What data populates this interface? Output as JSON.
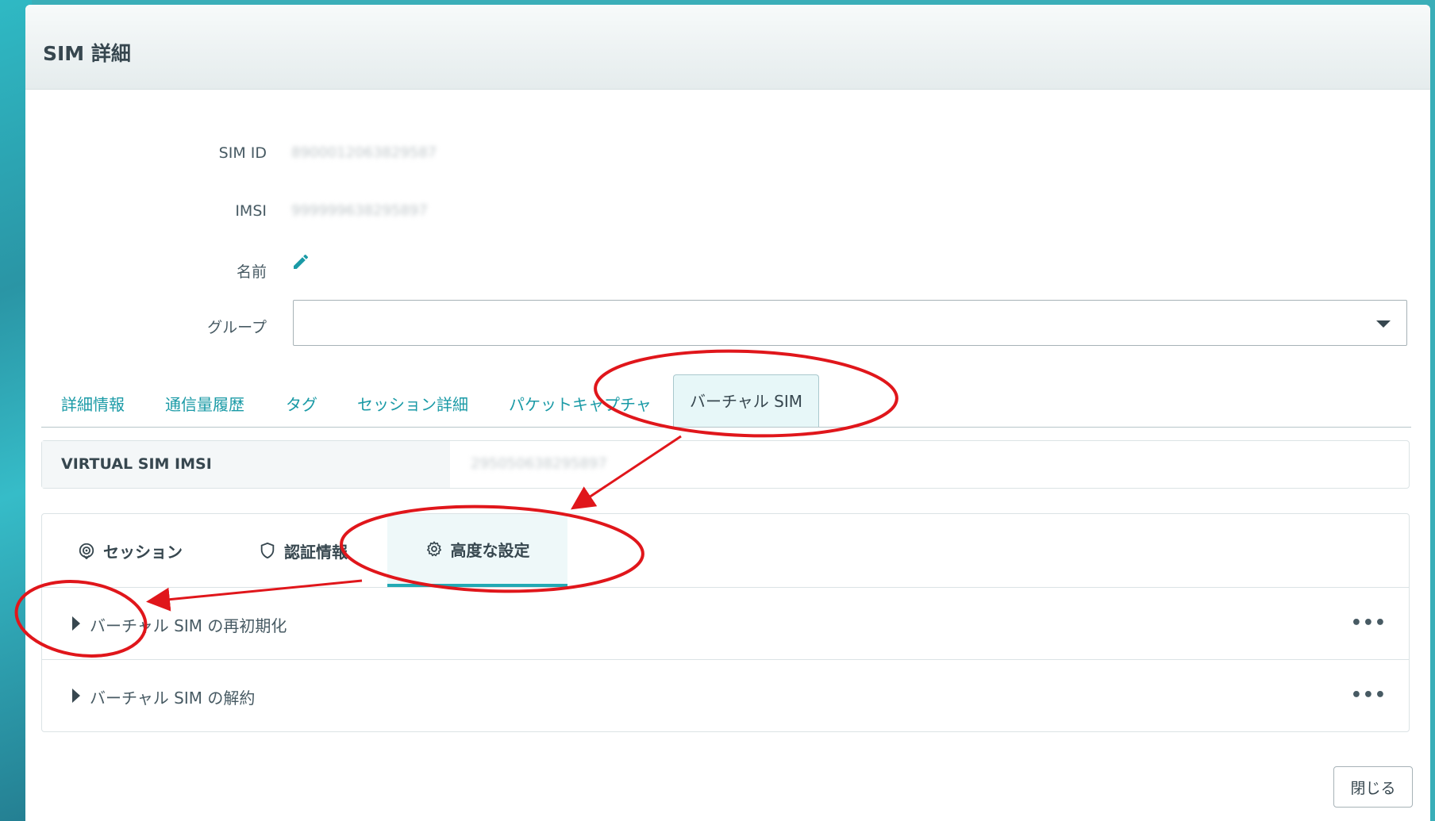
{
  "modal": {
    "title": "SIM 詳細"
  },
  "fields": {
    "sim_id_label": "SIM ID",
    "sim_id_value": "8900012063829587",
    "imsi_label": "IMSI",
    "imsi_value": "999999638295897",
    "name_label": "名前",
    "group_label": "グループ",
    "group_value": ""
  },
  "tabs": [
    {
      "label": "詳細情報"
    },
    {
      "label": "通信量履歴"
    },
    {
      "label": "タグ"
    },
    {
      "label": "セッション詳細"
    },
    {
      "label": "パケットキャプチャ"
    },
    {
      "label": "バーチャル SIM"
    }
  ],
  "active_tab": "バーチャル SIM",
  "virtual_sim": {
    "imsi_label": "VIRTUAL SIM IMSI",
    "imsi_value": "295050638295897"
  },
  "subtabs": [
    {
      "label": "セッション",
      "icon": "session-icon"
    },
    {
      "label": "認証情報",
      "icon": "shield-icon"
    },
    {
      "label": "高度な設定",
      "icon": "gear-icon"
    }
  ],
  "active_subtab": "高度な設定",
  "accordion": [
    {
      "label": "バーチャル SIM の再初期化"
    },
    {
      "label": "バーチャル SIM の解約"
    }
  ],
  "footer": {
    "close_label": "閉じる"
  },
  "colors": {
    "accent": "#22a9b4",
    "annotation": "#e0161b",
    "text": "#37474f"
  }
}
